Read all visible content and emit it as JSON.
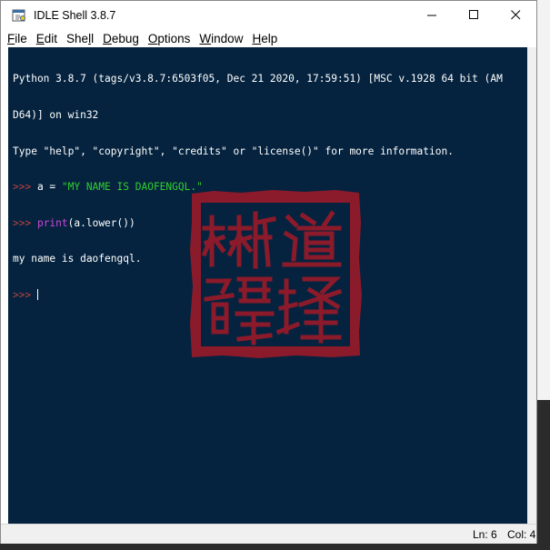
{
  "window": {
    "title": "IDLE Shell 3.8.7",
    "minimize_glyph": "—",
    "maximize_glyph": "☐",
    "close_glyph": "✕"
  },
  "menu": {
    "file": {
      "u": "F",
      "rest": "ile"
    },
    "edit": {
      "u": "E",
      "rest": "dit"
    },
    "shell": {
      "pre": "She",
      "u": "l",
      "rest": "l"
    },
    "debug": {
      "u": "D",
      "rest": "ebug"
    },
    "options": {
      "u": "O",
      "rest": "ptions"
    },
    "window": {
      "u": "W",
      "rest": "indow"
    },
    "help": {
      "u": "H",
      "rest": "elp"
    }
  },
  "shell": {
    "banner_1": "Python 3.8.7 (tags/v3.8.7:6503f05, Dec 21 2020, 17:59:51) [MSC v.1928 64 bit (AM",
    "banner_2": "D64)] on win32",
    "banner_3": "Type \"help\", \"copyright\", \"credits\" or \"license()\" for more information.",
    "prompt": ">>> ",
    "line4_code": "a = ",
    "line4_string": "\"MY NAME IS DAOFENGQL.\"",
    "line5_builtin": "print",
    "line5_rest": "(a.lower())",
    "output": "my name is daofengql."
  },
  "seal": {
    "characters": "道锋楚馨",
    "color": "#8b1a2a"
  },
  "colors": {
    "editor_bg": "#05233f",
    "prompt": "#c04040",
    "string": "#2fcf2f",
    "builtin": "#c848d8"
  },
  "status": {
    "line": "Ln: 6",
    "col": "Col: 4"
  }
}
